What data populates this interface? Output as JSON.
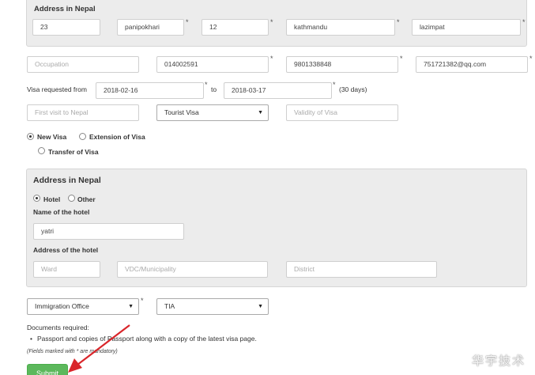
{
  "address_section_top": {
    "title": "Address in Nepal",
    "fields": [
      "23",
      "panipokhari",
      "12",
      "kathmandu",
      "lazimpat"
    ]
  },
  "contact_row": {
    "occupation_placeholder": "Occupation",
    "phone1": "014002591",
    "phone2": "9801338848",
    "email": "751721382@qq.com"
  },
  "visa_dates": {
    "label": "Visa requested from",
    "from": "2018-02-16",
    "to_label": "to",
    "to": "2018-03-17",
    "days_note": "(30 days)"
  },
  "visa_row": {
    "first_visit_placeholder": "First visit to Nepal",
    "visa_type": "Tourist Visa",
    "validity_placeholder": "Validity of Visa"
  },
  "visa_options": {
    "new": "New Visa",
    "extension": "Extension of Visa",
    "transfer": "Transfer of Visa"
  },
  "address_section_bottom": {
    "title": "Address in Nepal",
    "hotel_option": "Hotel",
    "other_option": "Other",
    "hotel_name_label": "Name of the hotel",
    "hotel_name": "yatri",
    "hotel_address_label": "Address of the hotel",
    "ward_placeholder": "Ward",
    "vdc_placeholder": "VDC/Municipality",
    "district_placeholder": "District"
  },
  "office_row": {
    "office": "Immigration Office",
    "location": "TIA"
  },
  "documents": {
    "label": "Documents required:",
    "item": "Passport and copies of Passport along with a copy of the latest visa page.",
    "note": "(Fields marked with * are mandatory)"
  },
  "submit_label": "Submit",
  "required_marker": "*",
  "watermark": "华宇技术",
  "colors": {
    "submit": "#5cb85c",
    "arrow": "#d9252a",
    "panel": "#ececec"
  }
}
